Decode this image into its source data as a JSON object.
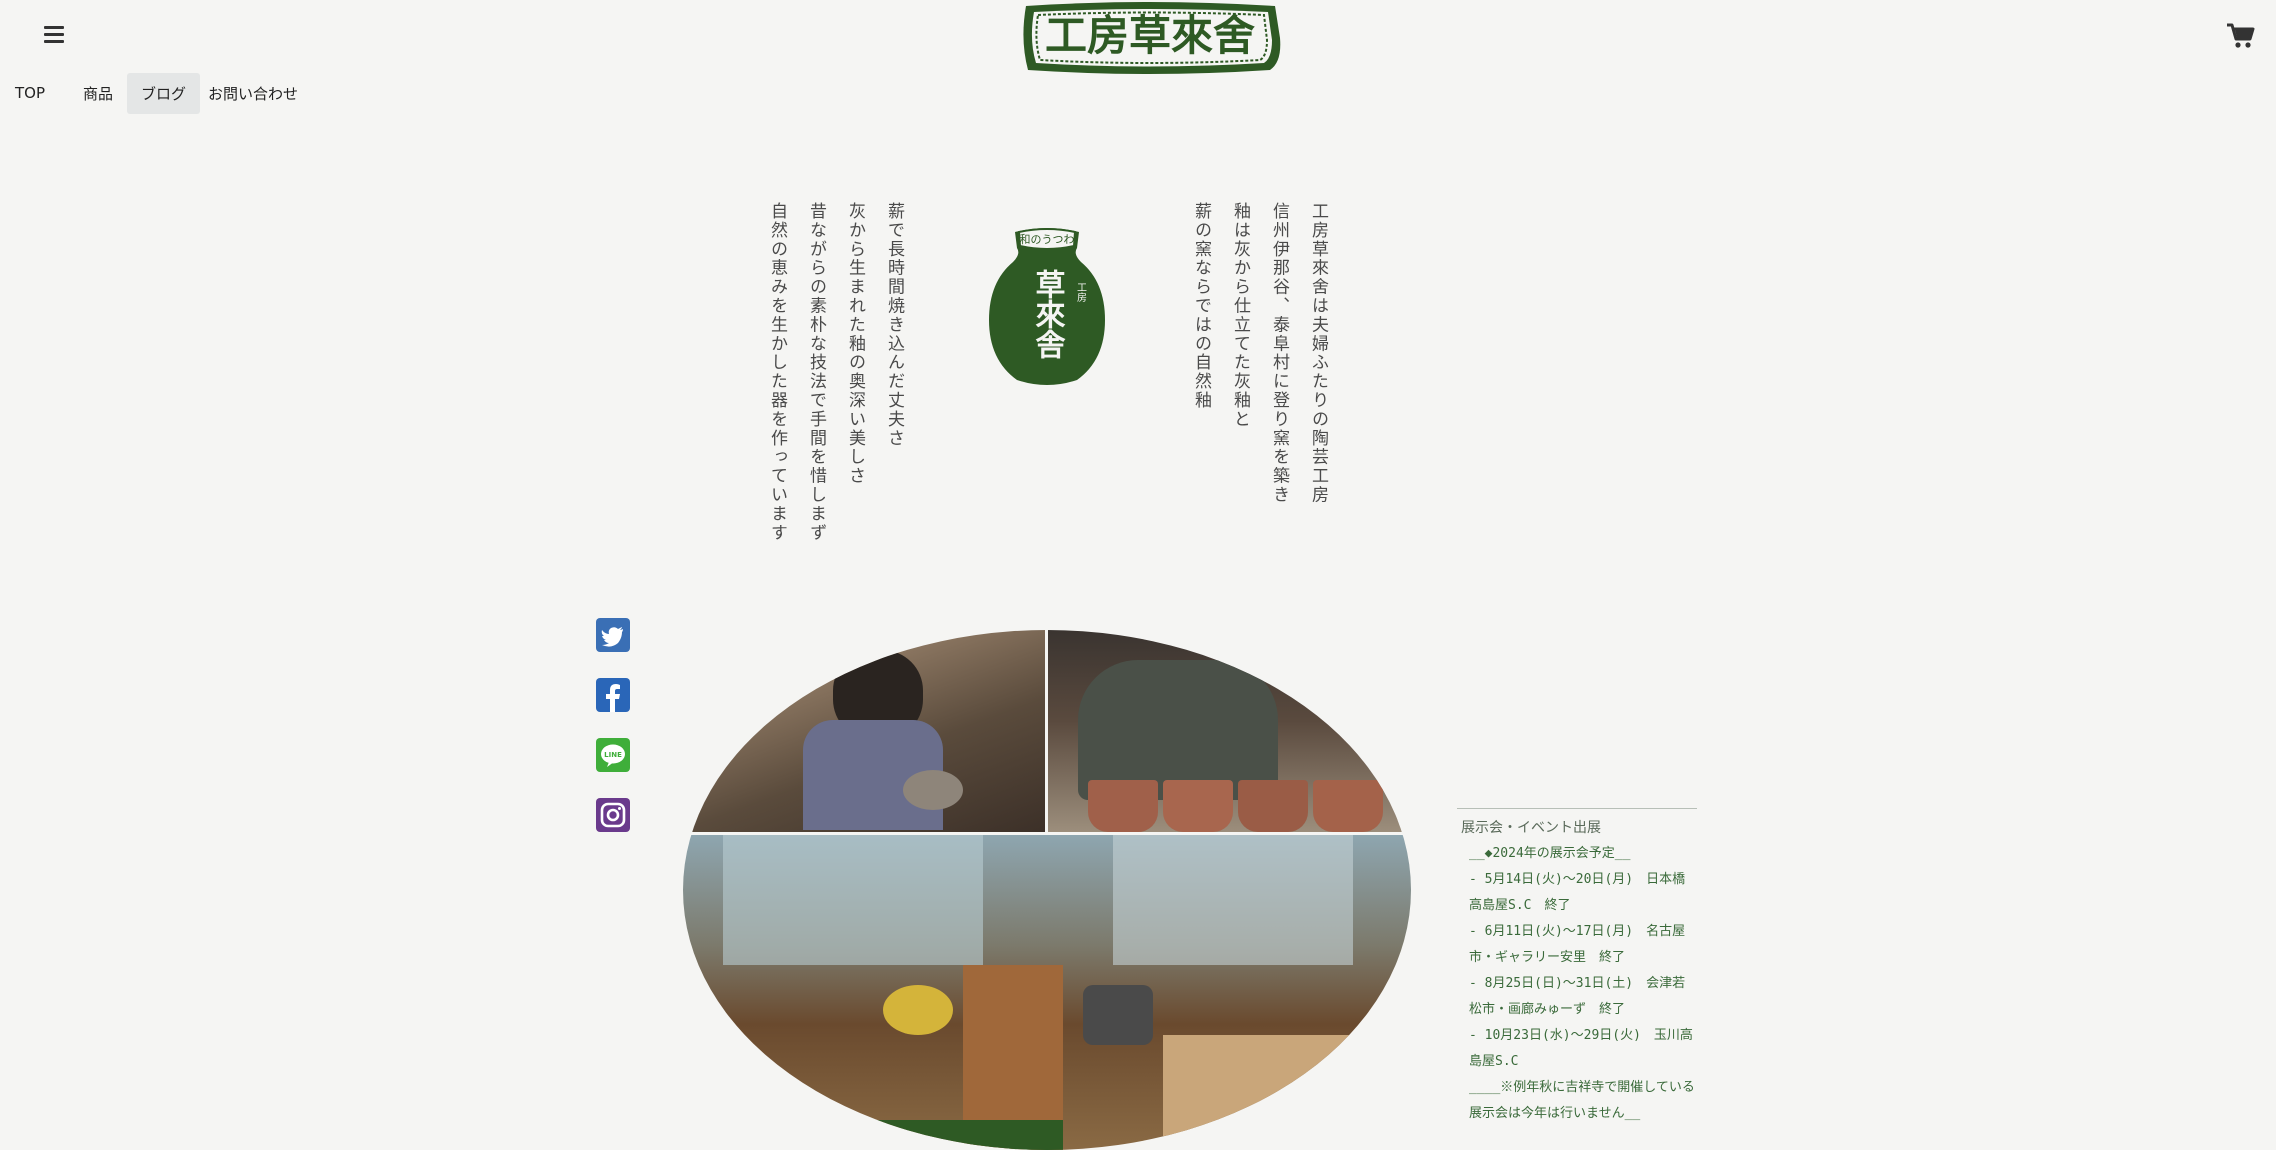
{
  "header": {
    "logo_text": "工房草來舍",
    "menu_icon": "hamburger-icon",
    "cart_icon": "cart-icon"
  },
  "nav": {
    "items": [
      {
        "label": "TOP"
      },
      {
        "label": "商品"
      },
      {
        "label": "ブログ"
      },
      {
        "label": "お問い合わせ"
      }
    ]
  },
  "intro": {
    "right": [
      "工房草來舍は夫婦ふたりの陶芸工房",
      "信州伊那谷、泰阜村に登り窯を築き",
      "釉は灰から仕立てた灰釉と",
      "薪の窯ならではの自然釉"
    ],
    "left": [
      "薪で長時間焼き込んだ丈夫さ",
      "灰から生まれた釉の奥深い美しさ",
      "昔ながらの素朴な技法で手間を惜しまず",
      "自然の恵みを生かした器を作っています"
    ]
  },
  "jar_logo": {
    "top_text": "和のうつわ",
    "main_text": "草來舎",
    "side_text": "工房"
  },
  "social": [
    "twitter-icon",
    "facebook-icon",
    "line-icon",
    "instagram-icon"
  ],
  "events": {
    "title": "展示会・イベント出展",
    "items": [
      "__◆2024年の展示会予定__",
      "- 5月14日(火)〜20日(月)　日本橋高島屋S.C　終了",
      "- 6月11日(火)〜17日(月)　名古屋市・ギャラリー安里　終了",
      "- 8月25日(日)〜31日(土)　会津若松市・画廊みゅーず　終了",
      "- 10月23日(水)〜29日(火)　玉川高島屋S.C",
      "____※例年秋に吉祥寺で開催している展示会は今年は行いません__"
    ]
  },
  "colors": {
    "accent": "#2e5a24",
    "background": "#f5f5f3",
    "twitter": "#3a6fb5",
    "facebook": "#2a66b8",
    "line": "#3fae3a",
    "instagram": "#6a3a8c"
  }
}
